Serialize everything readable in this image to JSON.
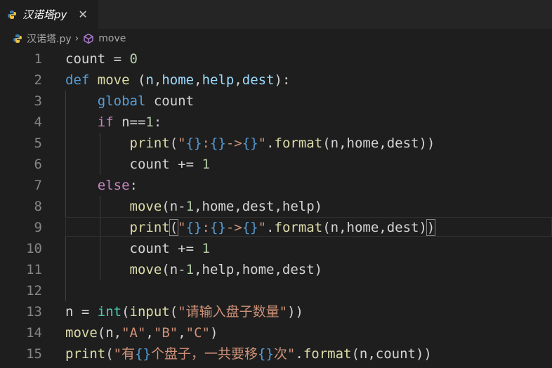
{
  "tab": {
    "title": "汉诺塔py",
    "close": "✕"
  },
  "breadcrumb": {
    "file": "汉诺塔.py",
    "separator": "›",
    "symbol": "move"
  },
  "code": [
    {
      "n": "1",
      "t": [
        [
          "count = ",
          ""
        ],
        [
          "0",
          "num"
        ]
      ]
    },
    {
      "n": "2",
      "t": [
        [
          "def",
          "kw"
        ],
        [
          " ",
          ""
        ],
        [
          "move",
          "fn"
        ],
        [
          " (",
          ""
        ],
        [
          "n",
          "par"
        ],
        [
          ",",
          ""
        ],
        [
          "home",
          "par"
        ],
        [
          ",",
          ""
        ],
        [
          "help",
          "par"
        ],
        [
          ",",
          ""
        ],
        [
          "dest",
          "par"
        ],
        [
          "):",
          ""
        ]
      ]
    },
    {
      "n": "3",
      "t": [
        [
          "    ",
          ""
        ],
        [
          "global",
          "kw"
        ],
        [
          " count",
          ""
        ]
      ]
    },
    {
      "n": "4",
      "t": [
        [
          "    ",
          ""
        ],
        [
          "if",
          "kc"
        ],
        [
          " n==",
          ""
        ],
        [
          "1",
          "num"
        ],
        [
          ":",
          ""
        ]
      ]
    },
    {
      "n": "5",
      "t": [
        [
          "        ",
          ""
        ],
        [
          "print",
          "fn"
        ],
        [
          "(",
          ""
        ],
        [
          "\"",
          "str"
        ],
        [
          "{}",
          "esc"
        ],
        [
          ":",
          "str"
        ],
        [
          "{}",
          "esc"
        ],
        [
          "->",
          "str"
        ],
        [
          "{}",
          "esc"
        ],
        [
          "\"",
          "str"
        ],
        [
          ".",
          ""
        ],
        [
          "format",
          "fn"
        ],
        [
          "(n,home,dest))",
          ""
        ]
      ]
    },
    {
      "n": "6",
      "t": [
        [
          "        count += ",
          ""
        ],
        [
          "1",
          "num"
        ]
      ]
    },
    {
      "n": "7",
      "t": [
        [
          "    ",
          ""
        ],
        [
          "else",
          "kc"
        ],
        [
          ":",
          ""
        ]
      ]
    },
    {
      "n": "8",
      "t": [
        [
          "        ",
          ""
        ],
        [
          "move",
          "fn"
        ],
        [
          "(n-",
          ""
        ],
        [
          "1",
          "num"
        ],
        [
          ",home,dest,help)",
          ""
        ]
      ]
    },
    {
      "n": "9",
      "t": [
        [
          "        ",
          ""
        ],
        [
          "print",
          "fn"
        ],
        [
          "(",
          "bm"
        ],
        [
          "\"",
          "str"
        ],
        [
          "{}",
          "esc"
        ],
        [
          ":",
          "str"
        ],
        [
          "{}",
          "esc"
        ],
        [
          "->",
          "str"
        ],
        [
          "{}",
          "esc"
        ],
        [
          "\"",
          "str"
        ],
        [
          ".",
          ""
        ],
        [
          "format",
          "fn"
        ],
        [
          "(n,home,dest)",
          ""
        ],
        [
          ")",
          "bm"
        ]
      ]
    },
    {
      "n": "10",
      "t": [
        [
          "        count += ",
          ""
        ],
        [
          "1",
          "num"
        ]
      ]
    },
    {
      "n": "11",
      "t": [
        [
          "        ",
          ""
        ],
        [
          "move",
          "fn"
        ],
        [
          "(n-",
          ""
        ],
        [
          "1",
          "num"
        ],
        [
          ",help,home,dest)",
          ""
        ]
      ]
    },
    {
      "n": "12",
      "t": []
    },
    {
      "n": "13",
      "t": [
        [
          "n = ",
          ""
        ],
        [
          "int",
          "ty"
        ],
        [
          "(",
          ""
        ],
        [
          "input",
          "fn"
        ],
        [
          "(",
          ""
        ],
        [
          "\"请输入盘子数量\"",
          "str"
        ],
        [
          "))",
          ""
        ]
      ]
    },
    {
      "n": "14",
      "t": [
        [
          "move",
          "fn"
        ],
        [
          "(n,",
          ""
        ],
        [
          "\"A\"",
          "str"
        ],
        [
          ",",
          ""
        ],
        [
          "\"B\"",
          "str"
        ],
        [
          ",",
          ""
        ],
        [
          "\"C\"",
          "str"
        ],
        [
          ")",
          ""
        ]
      ]
    },
    {
      "n": "15",
      "t": [
        [
          "print",
          "fn"
        ],
        [
          "(",
          ""
        ],
        [
          "\"有",
          "str"
        ],
        [
          "{}",
          "esc"
        ],
        [
          "个盘子，一共要移",
          "str"
        ],
        [
          "{}",
          "esc"
        ],
        [
          "次\"",
          "str"
        ],
        [
          ".",
          ""
        ],
        [
          "format",
          "fn"
        ],
        [
          "(n,count))",
          ""
        ]
      ]
    }
  ],
  "current_line": "9",
  "colors": {
    "background": "#1e1e1e",
    "keyword": "#569cd6",
    "control": "#c586c0",
    "function": "#dcdcaa",
    "string": "#ce9178",
    "number": "#b5cea8",
    "type": "#4ec9b0",
    "parameter": "#9cdcfe"
  }
}
